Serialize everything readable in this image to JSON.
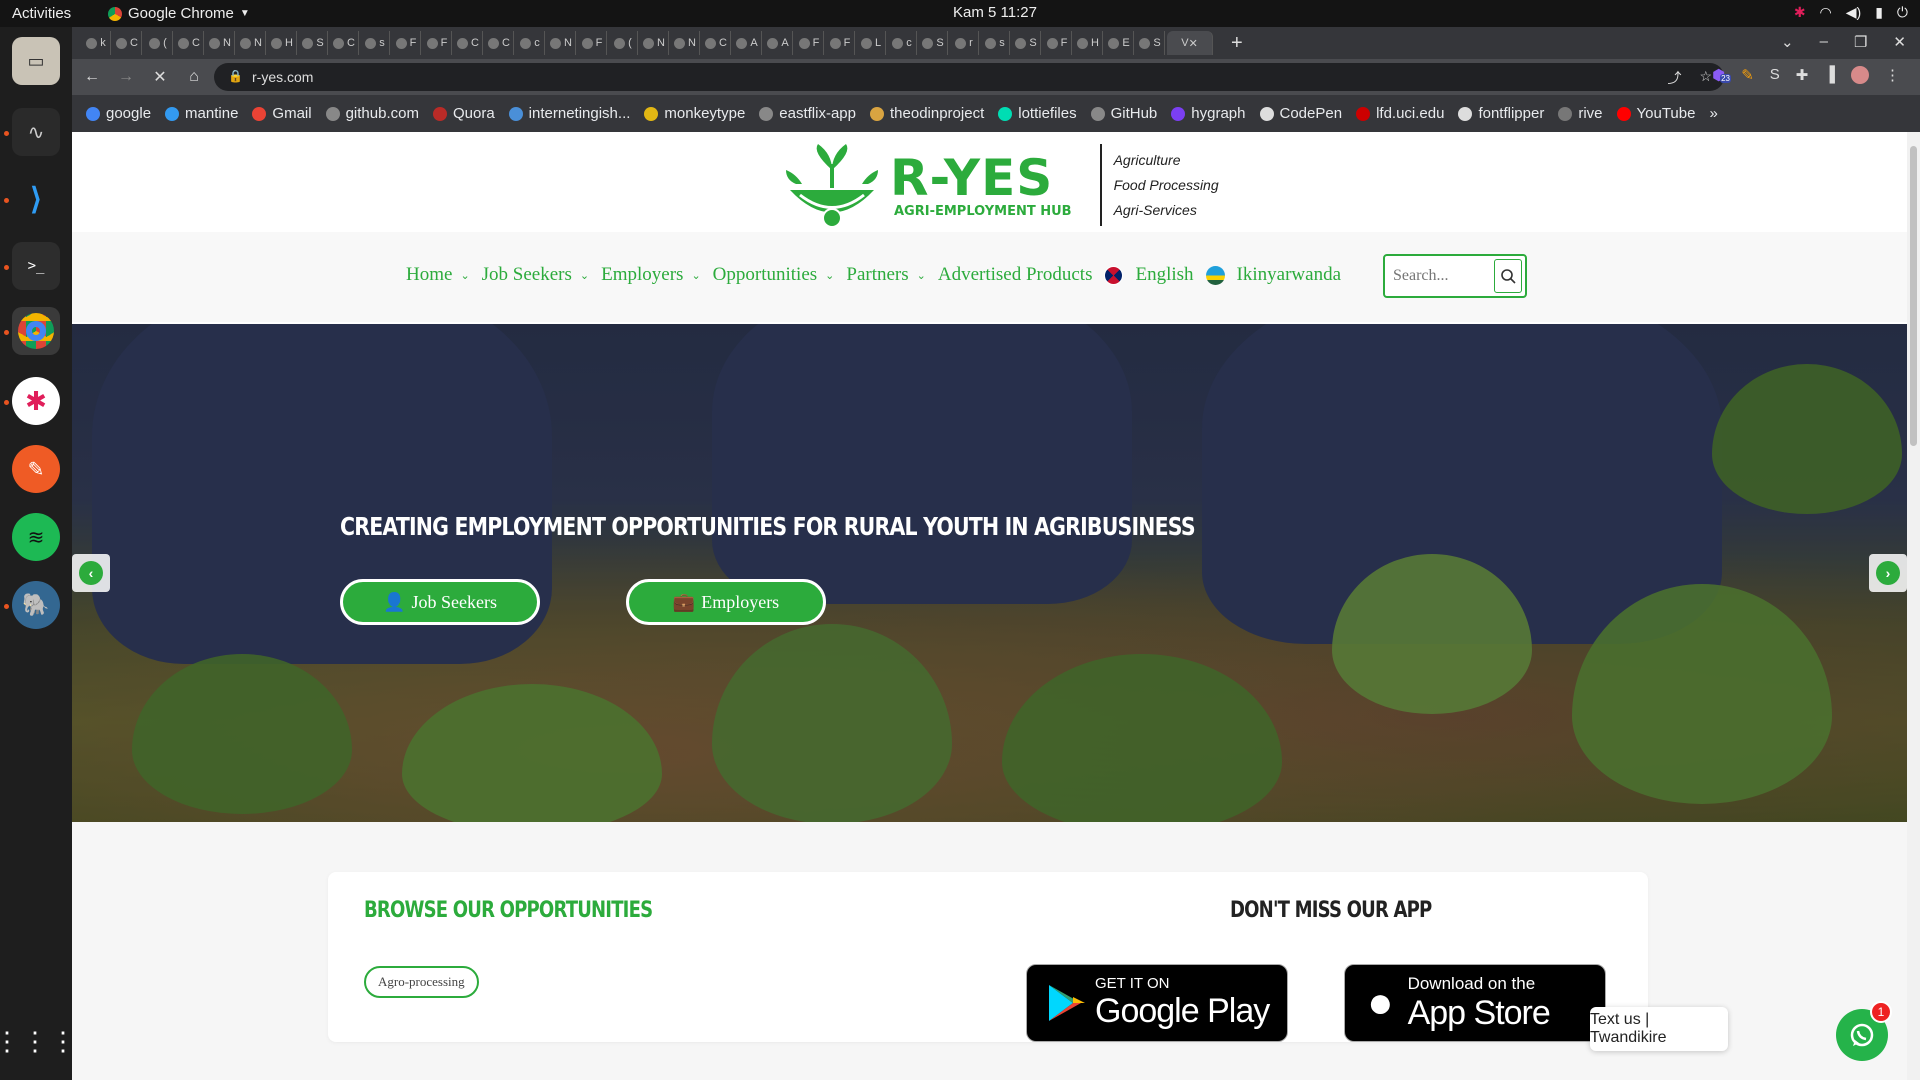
{
  "os": {
    "activities": "Activities",
    "app_name": "Google Chrome",
    "clock": "Kam 5  11:27"
  },
  "browser": {
    "url": "r-yes.com",
    "extension_badge": "23",
    "bookmarks": [
      {
        "label": "google",
        "color": "#4285f4"
      },
      {
        "label": "mantine",
        "color": "#339af0"
      },
      {
        "label": "Gmail",
        "color": "#ea4335"
      },
      {
        "label": "github.com",
        "color": "#888888"
      },
      {
        "label": "Quora",
        "color": "#b92b27"
      },
      {
        "label": "internetingish...",
        "color": "#4a8fd8"
      },
      {
        "label": "monkeytype",
        "color": "#e2b714"
      },
      {
        "label": "eastflix-app",
        "color": "#888888"
      },
      {
        "label": "theodinproject",
        "color": "#d9a441"
      },
      {
        "label": "lottiefiles",
        "color": "#00ddb3"
      },
      {
        "label": "GitHub",
        "color": "#888888"
      },
      {
        "label": "hygraph",
        "color": "#7b3ff2"
      },
      {
        "label": "CodePen",
        "color": "#dddddd"
      },
      {
        "label": "lfd.uci.edu",
        "color": "#cc0000"
      },
      {
        "label": "fontflipper",
        "color": "#dddddd"
      },
      {
        "label": "rive",
        "color": "#777777"
      },
      {
        "label": "YouTube",
        "color": "#ff0000"
      }
    ],
    "tabs": [
      "k",
      "C",
      "(",
      "C",
      "N",
      "N",
      "H",
      "S",
      "C",
      "s",
      "F",
      "F",
      "C",
      "C",
      "c",
      "N",
      "F",
      "(",
      "N",
      "N",
      "C",
      "A",
      "A",
      "F",
      "F",
      "L",
      "c",
      "S",
      "r",
      "s",
      "S",
      "F",
      "H",
      "E",
      "S"
    ],
    "active_tab": "V"
  },
  "site": {
    "brand_name": "R-YES",
    "brand_sub": "AGRI-EMPLOYMENT HUB",
    "taglines": [
      "Agriculture",
      "Food Processing",
      "Agri-Services"
    ],
    "nav": {
      "home": "Home",
      "job_seekers": "Job Seekers",
      "employers": "Employers",
      "opportunities": "Opportunities",
      "partners": "Partners",
      "advertised_products": "Advertised Products",
      "english": "English",
      "kinyarwanda": "Ikinyarwanda"
    },
    "search_placeholder": "Search...",
    "hero": {
      "headline": "CREATING EMPLOYMENT OPPORTUNITIES FOR RURAL YOUTH IN AGRIBUSINESS",
      "btn_job_seekers": "Job Seekers",
      "btn_employers": "Employers"
    },
    "browse": {
      "title": "BROWSE OUR OPPORTUNITIES",
      "chip": "Agro-processing"
    },
    "app": {
      "title": "DON'T MISS OUR APP",
      "google_top": "GET IT ON",
      "google_bottom": "Google Play",
      "apple_top": "Download on the",
      "apple_bottom": "App Store"
    },
    "chat": {
      "label": "Text us | Twandikire",
      "badge": "1"
    }
  },
  "colors": {
    "brand_green": "#2cab3c",
    "chrome_dark": "#35363a"
  }
}
